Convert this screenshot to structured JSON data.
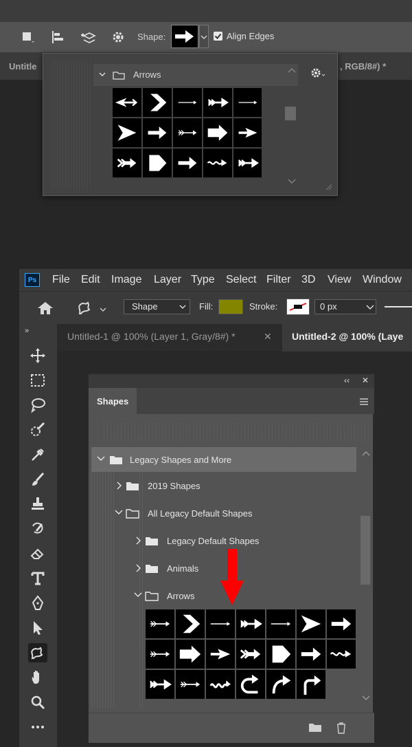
{
  "top_snippet": {
    "shape_label": "Shape:",
    "align_edges_label": "Align Edges",
    "align_edges_checked": true,
    "tab_left": "Untitle",
    "tab_right": ", RGB/8#) *",
    "picker": {
      "folder_label": "Arrows",
      "icons": [
        "arrow-dart",
        "chevron-large",
        "arrow-thin",
        "arrow-feathered",
        "arrow-thin",
        "arrowhead-triangle",
        "arrow-bold",
        "arrow-feathered-thin",
        "arrow-block",
        "arrowhead-small",
        "arrow-feathered-bold",
        "arrow-pentagon",
        "arrow-bold",
        "arrow-wavy",
        "arrow-feathered"
      ]
    }
  },
  "app": {
    "logo": "Ps",
    "menu": [
      "File",
      "Edit",
      "Image",
      "Layer",
      "Type",
      "Select",
      "Filter",
      "3D",
      "View",
      "Window"
    ],
    "options": {
      "mode": "Shape",
      "fill_label": "Fill:",
      "fill_color": "#838500",
      "stroke_label": "Stroke:",
      "stroke_width": "0 px"
    },
    "tabs": {
      "inactive": "Untitled-1 @ 100% (Layer 1, Gray/8#) *",
      "active": "Untitled-2 @ 100% (Laye"
    },
    "tools": [
      "move-tool",
      "marquee-tool",
      "lasso-tool",
      "quick-select-tool",
      "eyedropper-tool",
      "brush-tool",
      "stamp-tool",
      "history-brush-tool",
      "eraser-tool",
      "type-tool",
      "pen-tool",
      "path-select-tool",
      "custom-shape-tool",
      "hand-tool",
      "zoom-tool",
      "more-tools"
    ],
    "shapes_panel": {
      "title": "Shapes",
      "rows": [
        {
          "label": "Legacy Shapes and More",
          "expanded": true,
          "selected": true
        },
        {
          "label": "2019 Shapes",
          "expanded": false
        },
        {
          "label": "All Legacy Default Shapes",
          "expanded": true
        },
        {
          "label": "Legacy Default Shapes",
          "expanded": false
        },
        {
          "label": "Animals",
          "expanded": false
        },
        {
          "label": "Arrows",
          "expanded": true
        }
      ],
      "icons": [
        "arrow-feathered-thin",
        "chevron-large",
        "arrow-thin",
        "arrow-feathered",
        "arrow-thin",
        "arrowhead-triangle",
        "arrow-bold",
        "arrow-feathered-thin",
        "arrow-block",
        "arrowhead-small",
        "arrow-feathered-bold",
        "arrow-pentagon",
        "arrow-bold",
        "arrow-wavy",
        "arrow-feathered",
        "arrow-feathered-thin",
        "arrow-squiggle",
        "arrow-uturn",
        "arrow-curved",
        "arrow-corner"
      ]
    },
    "annotation_color": "#ff0000"
  }
}
